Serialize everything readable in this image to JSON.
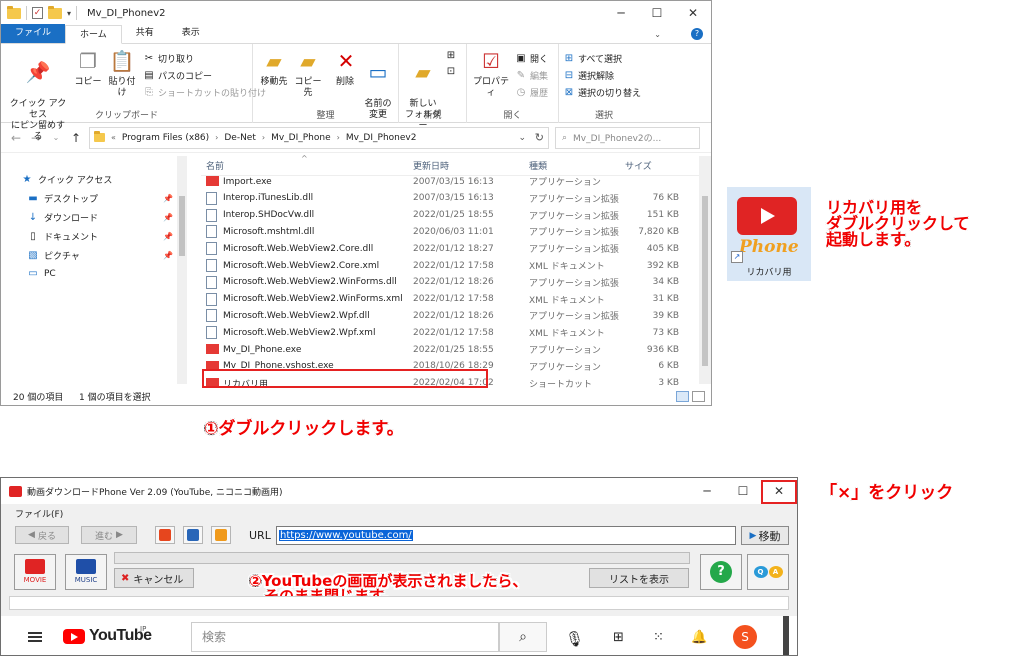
{
  "explorer": {
    "title": "Mv_DI_Phonev2",
    "tabs": [
      "ファイル",
      "ホーム",
      "共有",
      "表示"
    ],
    "ribbon": {
      "clipboard": {
        "pin": "クイック アクセス\nにピン留めする",
        "copy": "コピー",
        "paste": "貼り付け",
        "cut": "切り取り",
        "copy_path": "パスのコピー",
        "paste_shortcut": "ショートカットの貼り付け",
        "label": "クリップボード"
      },
      "organize": {
        "move_to": "移動先",
        "copy_to": "コピー先",
        "delete": "削除",
        "rename": "名前の\n変更",
        "label": "整理"
      },
      "new": {
        "new_folder": "新しい\nフォルダー",
        "label": "新規"
      },
      "open": {
        "properties": "プロパティ",
        "open": "開く",
        "edit": "編集",
        "history": "履歴",
        "label": "開く"
      },
      "select": {
        "select_all": "すべて選択",
        "select_none": "選択解除",
        "invert": "選択の切り替え",
        "label": "選択"
      }
    },
    "breadcrumb": [
      "Program Files (x86)",
      "De-Net",
      "Mv_DI_Phone",
      "Mv_DI_Phonev2"
    ],
    "search_placeholder": "Mv_DI_Phonev2の...",
    "nav": [
      {
        "label": "クイック アクセス",
        "icon": "star-icon"
      },
      {
        "label": "デスクトップ",
        "icon": "desktop-icon"
      },
      {
        "label": "ダウンロード",
        "icon": "download-icon"
      },
      {
        "label": "ドキュメント",
        "icon": "document-icon"
      },
      {
        "label": "ピクチャ",
        "icon": "pictures-icon"
      },
      {
        "label": "PC",
        "icon": "pc-icon"
      }
    ],
    "columns": {
      "name": "名前",
      "date": "更新日時",
      "type": "種類",
      "size": "サイズ"
    },
    "files": [
      {
        "name": "Import.exe",
        "date": "2007/03/15 16:13",
        "type": "アプリケーション",
        "size": ""
      },
      {
        "name": "Interop.iTunesLib.dll",
        "date": "2007/03/15 16:13",
        "type": "アプリケーション拡張",
        "size": "76 KB"
      },
      {
        "name": "Interop.SHDocVw.dll",
        "date": "2022/01/25 18:55",
        "type": "アプリケーション拡張",
        "size": "151 KB"
      },
      {
        "name": "Microsoft.mshtml.dll",
        "date": "2020/06/03 11:01",
        "type": "アプリケーション拡張",
        "size": "7,820 KB"
      },
      {
        "name": "Microsoft.Web.WebView2.Core.dll",
        "date": "2022/01/12 18:27",
        "type": "アプリケーション拡張",
        "size": "405 KB"
      },
      {
        "name": "Microsoft.Web.WebView2.Core.xml",
        "date": "2022/01/12 17:58",
        "type": "XML ドキュメント",
        "size": "392 KB"
      },
      {
        "name": "Microsoft.Web.WebView2.WinForms.dll",
        "date": "2022/01/12 18:26",
        "type": "アプリケーション拡張",
        "size": "34 KB"
      },
      {
        "name": "Microsoft.Web.WebView2.WinForms.xml",
        "date": "2022/01/12 17:58",
        "type": "XML ドキュメント",
        "size": "31 KB"
      },
      {
        "name": "Microsoft.Web.WebView2.Wpf.dll",
        "date": "2022/01/12 18:26",
        "type": "アプリケーション拡張",
        "size": "39 KB"
      },
      {
        "name": "Microsoft.Web.WebView2.Wpf.xml",
        "date": "2022/01/12 17:58",
        "type": "XML ドキュメント",
        "size": "73 KB"
      },
      {
        "name": "Mv_DI_Phone.exe",
        "date": "2022/01/25 18:55",
        "type": "アプリケーション",
        "size": "936 KB"
      },
      {
        "name": "Mv_DI_Phone.vshost.exe",
        "date": "2018/10/26 18:29",
        "type": "アプリケーション",
        "size": "6 KB"
      },
      {
        "name": "リカバリ用",
        "date": "2022/02/04 17:02",
        "type": "ショートカット",
        "size": "3 KB"
      }
    ],
    "status": {
      "count": "20 個の項目",
      "selected": "1 個の項目を選択"
    }
  },
  "shortcut": {
    "logo_text": "Phone",
    "label": "リカバリ用"
  },
  "annotations": {
    "a1": "リカバリ用を\nダブルクリックして\n起動します。",
    "a2": "①ダブルクリックします。",
    "a3": "「×」をクリック",
    "a4": "②YouTubeの画面が表示されましたら、\n　そのまま閉じます。"
  },
  "downloader": {
    "title": "動画ダウンロードPhone Ver 2.09 (YouTube, ニコニコ動画用)",
    "menu_file": "ファイル(F)",
    "back": "戻る",
    "forward": "進む",
    "url_label": "URL",
    "url": "https://www.youtube.com/",
    "go": "移動",
    "movie": "MOVIE",
    "music": "MUSIC",
    "cancel": "キャンセル",
    "list": "リストを表示",
    "help": "?"
  },
  "youtube": {
    "wordmark": "YouTube",
    "region": "JP",
    "search_placeholder": "検索",
    "avatar": "S"
  },
  "colors": {
    "accent": "#1a6fc4",
    "annotation_red": "#f00000",
    "youtube_red": "#ff0000"
  }
}
